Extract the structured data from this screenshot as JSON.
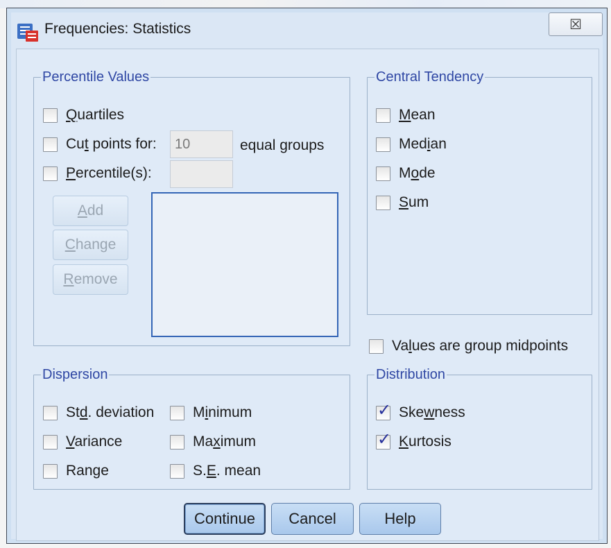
{
  "window": {
    "title": "Frequencies: Statistics",
    "close_glyph": "☒"
  },
  "percentile_values": {
    "legend": "Percentile Values",
    "quartiles": {
      "before": "",
      "key": "Q",
      "after": "uartiles",
      "checked": false
    },
    "cut_points": {
      "before": "Cu",
      "key": "t",
      "after": " points for:",
      "checked": false,
      "value": "10",
      "suffix": "equal groups"
    },
    "percentiles": {
      "before": "",
      "key": "P",
      "after": "ercentile(s):",
      "checked": false,
      "value": ""
    },
    "buttons": {
      "add": {
        "before": "",
        "key": "A",
        "after": "dd"
      },
      "change": {
        "before": "",
        "key": "C",
        "after": "hange"
      },
      "remove": {
        "before": "",
        "key": "R",
        "after": "emove"
      }
    }
  },
  "central_tendency": {
    "legend": "Central Tendency",
    "mean": {
      "before": "",
      "key": "M",
      "after": "ean",
      "checked": false
    },
    "median": {
      "before": "Med",
      "key": "i",
      "after": "an",
      "checked": false
    },
    "mode": {
      "before": "M",
      "key": "o",
      "after": "de",
      "checked": false
    },
    "sum": {
      "before": "",
      "key": "S",
      "after": "um",
      "checked": false
    }
  },
  "group_midpoints": {
    "before": "Va",
    "key": "l",
    "after": "ues are group midpoints",
    "checked": false
  },
  "dispersion": {
    "legend": "Dispersion",
    "std_deviation": {
      "before": "St",
      "key": "d",
      "after": ". deviation",
      "checked": false
    },
    "variance": {
      "before": "",
      "key": "V",
      "after": "ariance",
      "checked": false
    },
    "range": {
      "before": "Ran",
      "key": "g",
      "after": "e",
      "checked": false
    },
    "minimum": {
      "before": "M",
      "key": "i",
      "after": "nimum",
      "checked": false
    },
    "maximum": {
      "before": "Ma",
      "key": "x",
      "after": "imum",
      "checked": false
    },
    "se_mean": {
      "before": "S.",
      "key": "E",
      "after": ". mean",
      "checked": false
    }
  },
  "distribution": {
    "legend": "Distribution",
    "skewness": {
      "before": "Ske",
      "key": "w",
      "after": "ness",
      "checked": true
    },
    "kurtosis": {
      "before": "",
      "key": "K",
      "after": "urtosis",
      "checked": true
    }
  },
  "actions": {
    "continue": "Continue",
    "cancel": "Cancel",
    "help": "Help"
  },
  "check_glyph": "✓",
  "colors": {
    "legend": "#2f47a4",
    "check": "#26309c",
    "button": "#a9c8ec",
    "listbox_border": "#3465b6"
  }
}
